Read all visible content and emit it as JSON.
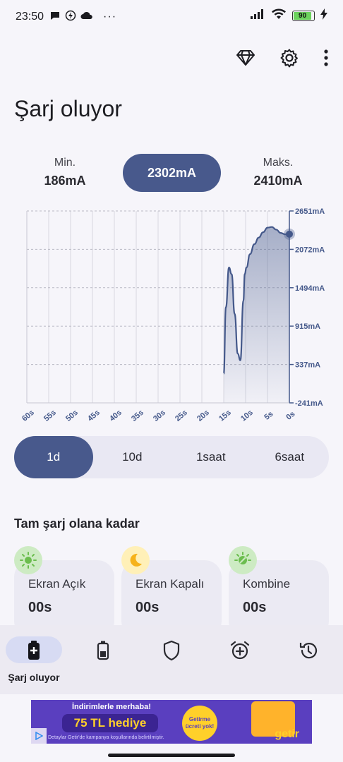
{
  "status_bar": {
    "time": "23:50",
    "battery": "90",
    "dots": "···"
  },
  "toolbar": {
    "icons": [
      "diamond-icon",
      "gear-icon",
      "more-vert-icon"
    ]
  },
  "page_title": "Şarj oluyor",
  "stats": {
    "min_label": "Min.",
    "min_value": "186mA",
    "current_value": "2302mA",
    "max_label": "Maks.",
    "max_value": "2410mA"
  },
  "chart_data": {
    "type": "area",
    "x": [
      -15,
      -14.5,
      -13.8,
      -13.2,
      -12.5,
      -11.8,
      -11.2,
      -10.5,
      -10.2,
      -9.8,
      -9,
      -8,
      -7,
      -6,
      -5,
      -4,
      -3,
      -2,
      -1,
      0
    ],
    "values": [
      200,
      1200,
      1800,
      1700,
      1100,
      500,
      400,
      1300,
      1700,
      1800,
      2000,
      2150,
      2250,
      2330,
      2400,
      2410,
      2370,
      2320,
      2300,
      2302
    ],
    "x_ticks": [
      "60s",
      "55s",
      "50s",
      "45s",
      "40s",
      "35s",
      "30s",
      "25s",
      "20s",
      "15s",
      "10s",
      "5s",
      "0s"
    ],
    "y_ticks": [
      "2651mA",
      "2072mA",
      "1494mA",
      "915mA",
      "337mA",
      "-241mA"
    ],
    "ylim": [
      -241,
      2651
    ],
    "xlim": [
      -60,
      0
    ],
    "grid": true,
    "color": "#44588a"
  },
  "segments": [
    "1d",
    "10d",
    "1saat",
    "6saat"
  ],
  "active_segment": 0,
  "section_title": "Tam şarj olana kadar",
  "cards": [
    {
      "label": "Ekran Açık",
      "value": "00s",
      "icon": "sun-icon",
      "badge_color": "#cdebc3",
      "icon_color": "#6bbd4e"
    },
    {
      "label": "Ekran Kapalı",
      "value": "00s",
      "icon": "moon-icon",
      "badge_color": "#fff0b8",
      "icon_color": "#f6b21a"
    },
    {
      "label": "Kombine",
      "value": "00s",
      "icon": "combined-icon",
      "badge_color": "#cdebc3",
      "icon_color": "#6bbd4e"
    }
  ],
  "bottom_nav": {
    "active_label": "Şarj oluyor",
    "items": [
      "charging-battery-icon",
      "battery-icon",
      "shield-icon",
      "alarm-add-icon",
      "history-icon"
    ]
  },
  "ad": {
    "headline": "İndirimlerle merhaba!",
    "promo": "75 TL hediye",
    "badge": "Getirme ücreti yok!",
    "footnote": "Detaylar Getir'de kampanya koşullarında belirtilmiştir.",
    "brand": "getir"
  }
}
